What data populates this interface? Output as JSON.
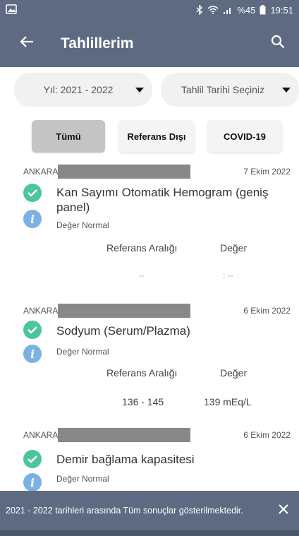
{
  "status_bar": {
    "battery_text": "%45",
    "time": "19:51",
    "icons": [
      "image-icon",
      "bluetooth-icon",
      "wifi-icon",
      "signal-icon",
      "battery-icon"
    ]
  },
  "app_bar": {
    "title": "Tahlillerim",
    "back_icon": "arrow-left-icon",
    "search_icon": "search-icon"
  },
  "filters": {
    "year_label": "Yıl: 2021 - 2022",
    "date_label": "Tahlil Tarihi Seçiniz"
  },
  "tabs": [
    {
      "label": "Tümü",
      "active": true
    },
    {
      "label": "Referans Dışı",
      "active": false
    },
    {
      "label": "COVID-19",
      "active": false
    }
  ],
  "entries": [
    {
      "city": "ANKARA",
      "date": "7 Ekim 2022",
      "name": "Kan Sayımı Otomatik Hemogram (geniş panel)",
      "status": "Değer Normal",
      "ref_header": "Referans Aralığı",
      "value_header": "Değer",
      "ref_value": "--",
      "value": ": --"
    },
    {
      "city": "ANKARA",
      "date": "6 Ekim 2022",
      "name": "Sodyum (Serum/Plazma)",
      "status": "Değer Normal",
      "ref_header": "Referans Aralığı",
      "value_header": "Değer",
      "ref_value": "136 - 145",
      "value": "139 mEq/L"
    },
    {
      "city": "ANKARA",
      "date": "6 Ekim 2022",
      "name": "Demir bağlama kapasitesi",
      "status": "Değer Normal"
    }
  ],
  "banner": {
    "text": "2021 - 2022 tarihleri arasında Tüm sonuçlar gösterilmektedir.",
    "close_icon": "close-icon"
  },
  "colors": {
    "app_bar": "#5d6a82",
    "check_green": "#4cc59c",
    "info_blue": "#7cb1e3",
    "active_tab": "#c4c4c4"
  }
}
